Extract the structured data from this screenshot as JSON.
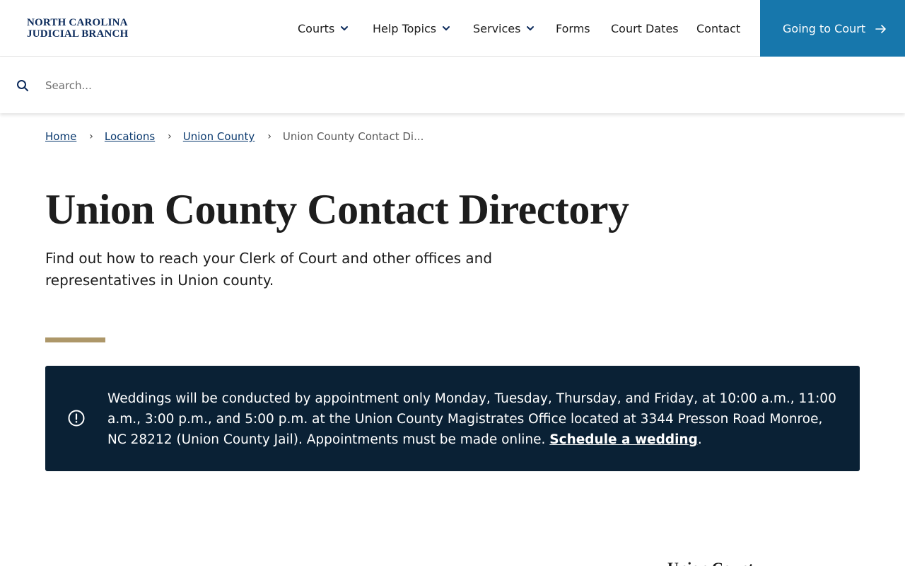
{
  "colors": {
    "brand_navy": "#0b2a5b",
    "cta_blue": "#1777ac",
    "alert_bg": "#0a2135",
    "accent_gold": "#ad9769",
    "link_blue": "#0b3a6f"
  },
  "header": {
    "logo_line1": "NORTH CAROLINA",
    "logo_line2": "JUDICIAL BRANCH",
    "nav": [
      {
        "label": "Courts",
        "has_dropdown": true
      },
      {
        "label": "Help Topics",
        "has_dropdown": true
      },
      {
        "label": "Services",
        "has_dropdown": true
      },
      {
        "label": "Forms",
        "has_dropdown": false
      },
      {
        "label": "Court Dates",
        "has_dropdown": false
      },
      {
        "label": "Contact",
        "has_dropdown": false
      }
    ],
    "cta_label": "Going to Court",
    "cta_icon": "arrow-right-icon"
  },
  "search": {
    "placeholder": "Search...",
    "value": "",
    "icon": "search-icon"
  },
  "breadcrumb": {
    "items": [
      "Home",
      "Locations",
      "Union County"
    ],
    "current": "Union County Contact Di..."
  },
  "main": {
    "title": "Union County Contact Directory",
    "intro": "Find out how to reach your Clerk of Court and other offices and representatives in Union county."
  },
  "alert": {
    "icon": "exclamation-circle-icon",
    "text": "Weddings will be conducted by appointment only Monday, Tuesday, Thursday, and Friday, at 10:00 a.m., 11:00 a.m., 3:00 p.m., and 5:00 p.m. at the Union County Magistrates Office located at 3344 Presson Road Monroe, NC 28212 (Union County Jail). Appointments must be made online. ",
    "link_label": "Schedule a wedding",
    "trailing": "."
  },
  "partial": {
    "heading": "Union County"
  }
}
